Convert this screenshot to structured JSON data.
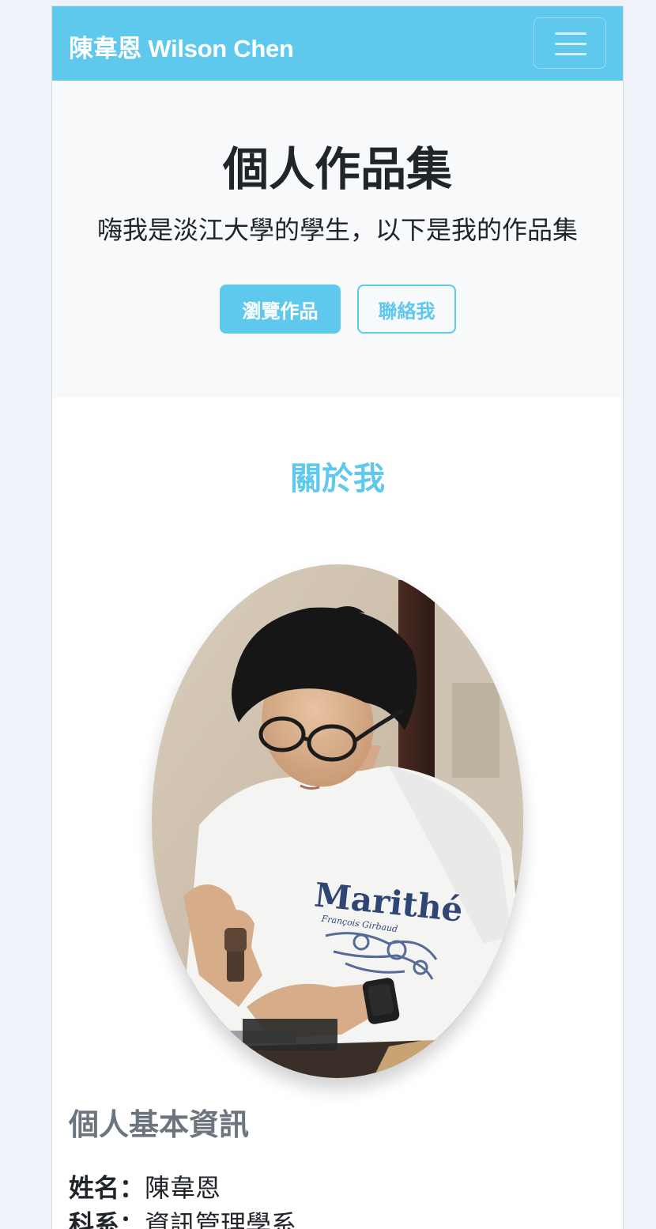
{
  "navbar": {
    "brand": "陳韋恩 Wilson Chen",
    "toggler_icon": "hamburger-menu-icon"
  },
  "hero": {
    "title": "個人作品集",
    "subtitle": "嗨我是淡江大學的學生，以下是我的作品集",
    "primary_button": "瀏覽作品",
    "secondary_button": "聯絡我"
  },
  "about": {
    "title": "關於我",
    "photo_print_text": "Marithé",
    "photo_print_subtext": "François Girbaud"
  },
  "info": {
    "title": "個人基本資訊",
    "rows": [
      {
        "label": "姓名：",
        "value": "陳韋恩"
      },
      {
        "label": "科系：",
        "value": "資訊管理學系"
      }
    ]
  },
  "colors": {
    "accent": "#5fc8ed",
    "hero_bg": "#f8f9fb",
    "text": "#212529",
    "muted": "#6c757d"
  }
}
